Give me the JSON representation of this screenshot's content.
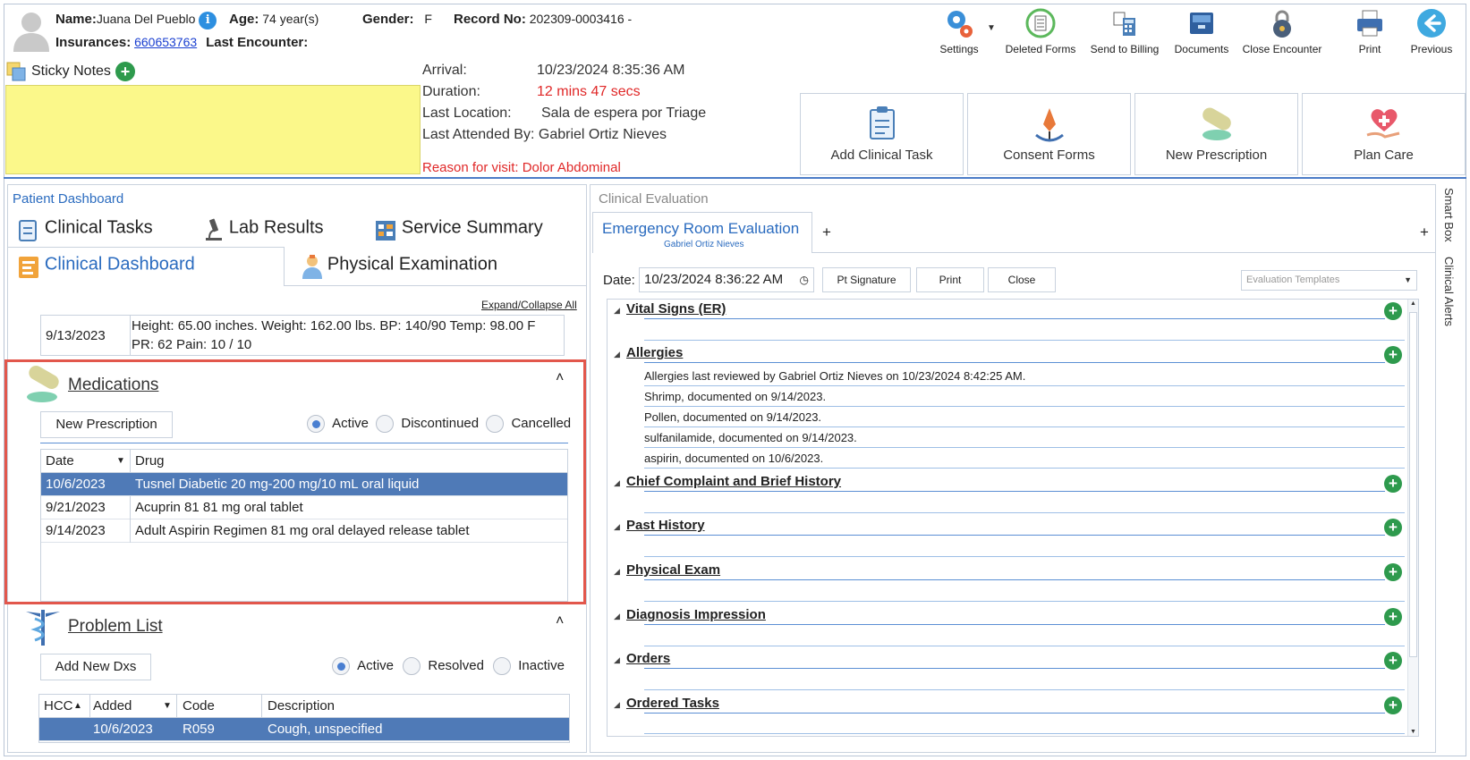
{
  "header": {
    "name_label": "Name:",
    "name_value": "Juana Del Pueblo",
    "info": "i",
    "age_label": "Age:",
    "age_value": "74 year(s)",
    "gender_label": "Gender:",
    "gender_value": "F",
    "record_label": "Record No:",
    "record_value": "202309-0003416 -",
    "insurances_label": "Insurances:",
    "insurances_value": "660653763",
    "last_encounter_label": "Last Encounter:"
  },
  "toolbar": {
    "settings": "Settings",
    "deleted_forms": "Deleted Forms",
    "send_to_billing": "Send to Billing",
    "documents": "Documents",
    "close_encounter": "Close Encounter",
    "print": "Print",
    "previous": "Previous"
  },
  "sticky": {
    "label": "Sticky Notes",
    "add": "+"
  },
  "visit": {
    "arrival_label": "Arrival:",
    "arrival_value": "10/23/2024 8:35:36 AM",
    "duration_label": "Duration:",
    "duration_value": "12 mins 47 secs",
    "last_location_label": "Last Location:",
    "last_location_value": "Sala de espera por Triage",
    "last_attended": "Last Attended By: Gabriel Ortiz Nieves",
    "reason": "Reason for visit: Dolor Abdominal"
  },
  "actions": {
    "add_clinical_task": "Add Clinical Task",
    "consent_forms": "Consent Forms",
    "new_prescription": "New Prescription",
    "plan_care": "Plan Care"
  },
  "dashboard": {
    "title": "Patient Dashboard",
    "tabs": {
      "clinical_tasks": "Clinical Tasks",
      "lab_results": "Lab Results",
      "service_summary": "Service Summary",
      "clinical_dashboard": "Clinical Dashboard",
      "physical_examination": "Physical Examination"
    },
    "expand_collapse": "Expand/Collapse All",
    "vitals_row": {
      "date": "9/13/2023",
      "line1": "Height: 65.00 inches. Weight: 162.00 lbs. BP: 140/90 Temp: 98.00 F",
      "line2": "PR: 62 Pain: 10 / 10"
    },
    "medications": {
      "title": "Medications",
      "collapse": "˄",
      "new_button": "New Prescription",
      "filters": [
        "Active",
        "Discontinued",
        "Cancelled"
      ],
      "columns": [
        "Date",
        "Drug"
      ],
      "rows": [
        {
          "date": "10/6/2023",
          "drug": "Tusnel Diabetic 20 mg-200 mg/10 mL oral liquid"
        },
        {
          "date": "9/21/2023",
          "drug": "Acuprin 81 81 mg oral tablet"
        },
        {
          "date": "9/14/2023",
          "drug": "Adult Aspirin Regimen 81 mg oral delayed release tablet"
        }
      ]
    },
    "problems": {
      "title": "Problem List",
      "collapse": "˄",
      "new_button": "Add New Dxs",
      "filters": [
        "Active",
        "Resolved",
        "Inactive"
      ],
      "columns": [
        "HCC",
        "Added",
        "Code",
        "Description"
      ],
      "rows": [
        {
          "hcc": "",
          "added": "10/6/2023",
          "code": "R059",
          "description": "Cough, unspecified"
        }
      ]
    }
  },
  "evaluation": {
    "title": "Clinical Evaluation",
    "tab_title": "Emergency Room Evaluation",
    "tab_subtitle": "Gabriel Ortiz Nieves",
    "add_tab": "+",
    "add_tab_right": "+",
    "date_label": "Date:",
    "date_value": "10/23/2024 8:36:22 AM",
    "pt_signature": "Pt Signature",
    "print": "Print",
    "close": "Close",
    "templates_placeholder": "Evaluation Templates",
    "sections": [
      "Vital Signs (ER)",
      "Allergies",
      "Chief Complaint and Brief History",
      "Past History",
      "Physical Exam",
      "Diagnosis Impression",
      "Orders",
      "Ordered Tasks"
    ],
    "allergies": [
      "Allergies last reviewed by Gabriel Ortiz Nieves on 10/23/2024 8:42:25 AM.",
      "Shrimp, documented on 9/14/2023.",
      "Pollen, documented on 9/14/2023.",
      "sulfanilamide, documented on 9/14/2023.",
      "aspirin, documented on 10/6/2023."
    ]
  },
  "sidebar": {
    "smart_box": "Smart Box",
    "clinical_alerts": "Clinical Alerts"
  }
}
